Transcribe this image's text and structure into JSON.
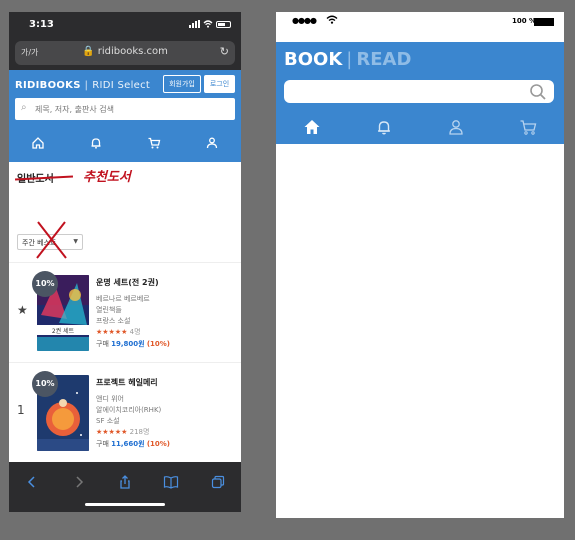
{
  "phone": {
    "status": {
      "time": "3:13"
    },
    "browser": {
      "aa_label": "가/가",
      "url": "ridibooks.com",
      "lock_icon": "lock-icon",
      "reload_icon": "reload-icon"
    },
    "header": {
      "logo_main": "RIDIBOOKS",
      "logo_sub": "RIDI Select",
      "signup_label": "회원가입",
      "login_label": "로그인",
      "search_placeholder": "제목, 저자, 출판사 검색"
    },
    "nav_icons": [
      "home-icon",
      "bell-icon",
      "cart-icon",
      "user-icon"
    ],
    "tabs": {
      "general": "일반도서",
      "new": "추천도서"
    },
    "filter": {
      "selected": "주간 베스트"
    },
    "books": [
      {
        "rank": "★",
        "discount": "10%",
        "title": "운명 세트(전 2권)",
        "author": "베르나르 베르베르",
        "publisher": "열린책들",
        "category": "프랑스 소설",
        "stars": "★★★★★",
        "rating_count": "4명",
        "price_prefix": "구매",
        "price": "19,800원",
        "price_discount": "(10%)",
        "cover_badge": "2권 세트"
      },
      {
        "rank": "1",
        "discount": "10%",
        "title": "프로젝트 헤일메리",
        "author": "앤디 위어",
        "publisher": "알에이치코리아(RHK)",
        "category": "SF 소설",
        "stars": "★★★★★",
        "rating_count": "218명",
        "price_prefix": "구매",
        "price": "11,660원",
        "price_discount": "(10%)"
      }
    ],
    "toolbar_icons": [
      "back-icon",
      "forward-icon",
      "share-icon",
      "book-icon",
      "tabs-icon"
    ]
  },
  "wireframe": {
    "status": {
      "dots": "●●●●",
      "battery": "100 %"
    },
    "logo_left": "BOOK",
    "logo_sep": "|",
    "logo_right": "READ",
    "nav_icons": [
      "home-icon",
      "bell-icon",
      "user-icon",
      "cart-icon"
    ],
    "accent": "#3b86cf"
  },
  "colors": {
    "accent": "#3b86cf",
    "annotation": "#c1121f",
    "price": "#1f6fd1",
    "discount": "#e0592a"
  }
}
